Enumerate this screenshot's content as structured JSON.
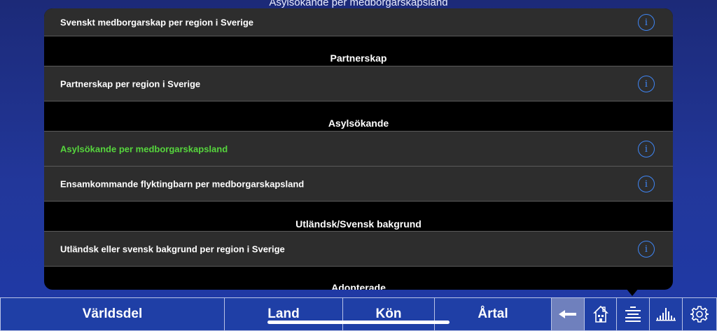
{
  "background_title": "Asylsökande per medborgarskapsland",
  "list": {
    "rows": [
      {
        "label": "Svenskt medborgarskap per region i Sverige",
        "active": false
      },
      {
        "label": "Partnerskap per region i Sverige",
        "active": false
      },
      {
        "label": "Asylsökande per medborgarskapsland",
        "active": true
      },
      {
        "label": "Ensamkommande flyktingbarn per medborgarskapsland",
        "active": false
      },
      {
        "label": "Utländsk eller svensk bakgrund per region i Sverige",
        "active": false
      }
    ],
    "sections": [
      "Partnerskap",
      "Asylsökande",
      "Utländsk/Svensk bakgrund",
      "Adopterade"
    ],
    "info_glyph": "i"
  },
  "toolbar": {
    "segments": [
      "Världsdel",
      "Land",
      "Kön",
      "Årtal"
    ],
    "icons": [
      "back-arrow-icon",
      "house-icon",
      "list-icon",
      "bar-chart-icon",
      "gear-icon"
    ]
  },
  "colors": {
    "active_text": "#56d63d",
    "info_blue": "#3f86f5",
    "row_bg": "#2d2d2d",
    "toolbar_blue": "#1f3fa6"
  }
}
